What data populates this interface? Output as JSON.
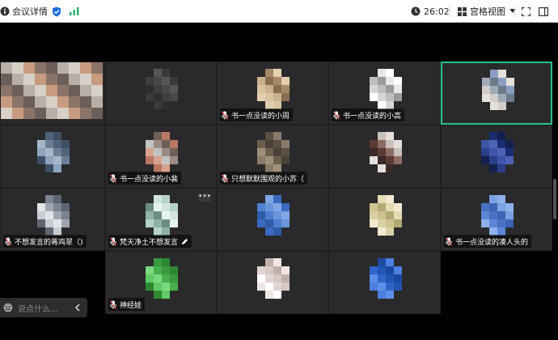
{
  "topbar": {
    "meeting_details": "会议详情",
    "time": "26:02",
    "view_mode": "宫格视图"
  },
  "participants": [
    {
      "id": 1,
      "name": ""
    },
    {
      "id": 2,
      "name": ""
    },
    {
      "id": 3,
      "name": "书一点没读的小周"
    },
    {
      "id": 4,
      "name": "书一点没读的小高"
    },
    {
      "id": 5,
      "name": ""
    },
    {
      "id": 6,
      "name": ""
    },
    {
      "id": 7,
      "name": "书一点没读的小裴"
    },
    {
      "id": 8,
      "name": "只想默默围观的小苏（"
    },
    {
      "id": 9,
      "name": ""
    },
    {
      "id": 10,
      "name": ""
    },
    {
      "id": 11,
      "name": "不想发言的蒋鸡翠（)"
    },
    {
      "id": 12,
      "name": "梵天净土不想发言"
    },
    {
      "id": 13,
      "name": ""
    },
    {
      "id": 14,
      "name": ""
    },
    {
      "id": 15,
      "name": "书一点没读的凑人头的"
    },
    {
      "id": 16,
      "name": "神经娃"
    },
    {
      "id": 17,
      "name": ""
    },
    {
      "id": 18,
      "name": ""
    }
  ],
  "chat": {
    "placeholder": "说点什么..."
  },
  "colors": {
    "tile_bg": "#2a2a2c",
    "active_border": "#28c28a",
    "mic_icon": "#e35b5b"
  }
}
